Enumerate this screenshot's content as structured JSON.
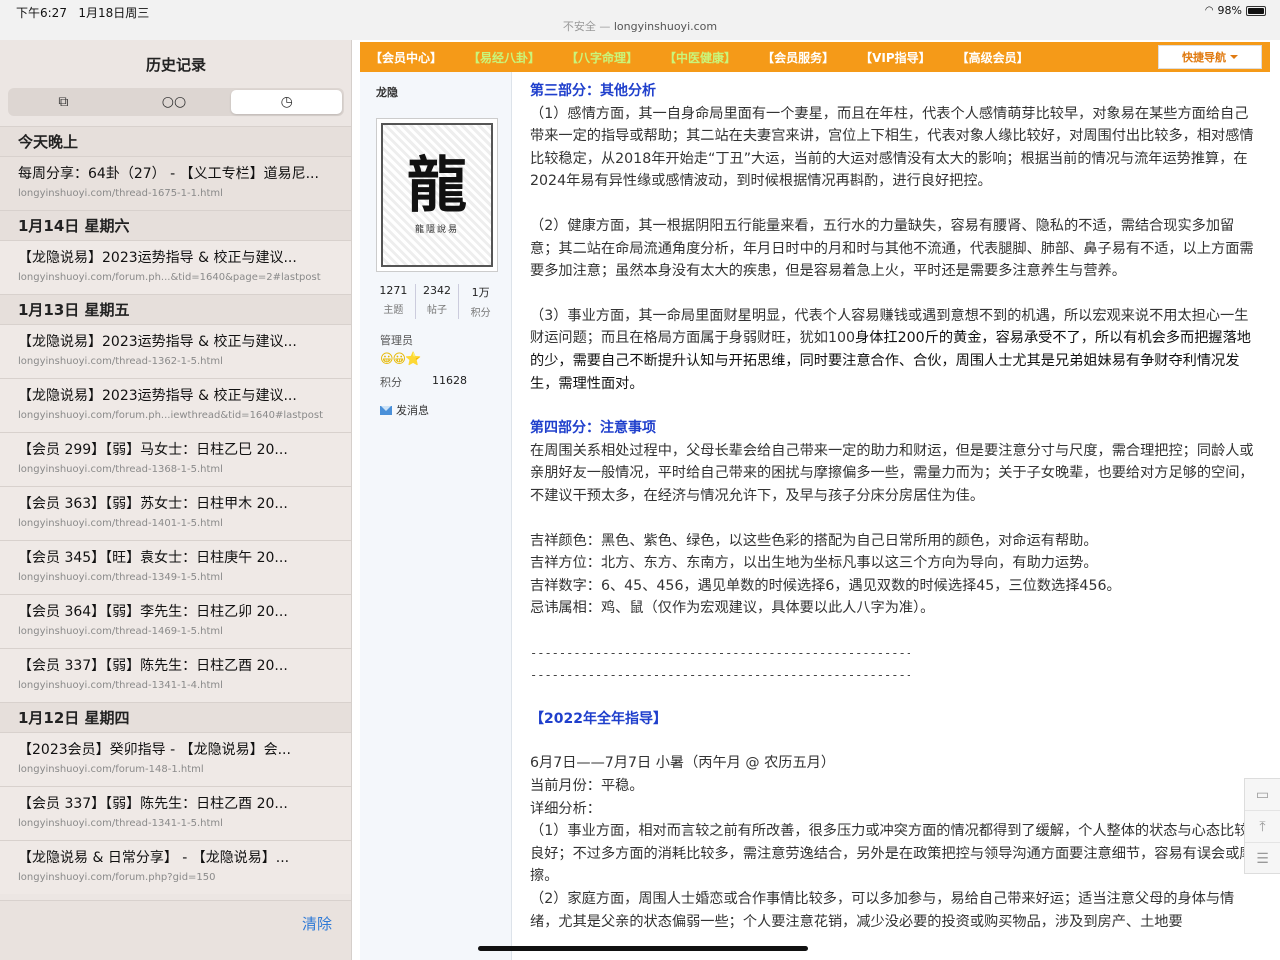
{
  "status_bar": {
    "time": "下午6:27",
    "date": "1月18日周三",
    "url_prefix": "不安全 — ",
    "url": "longyinshuoyi.com",
    "battery": "98%"
  },
  "sidebar": {
    "title": "历史记录",
    "tabs": [
      {
        "icon": "book-icon",
        "glyph": "⧉"
      },
      {
        "icon": "reading-list-icon",
        "glyph": "○○"
      },
      {
        "icon": "history-clock-icon",
        "glyph": "◷"
      }
    ],
    "groups": [
      {
        "header": "今天晚上",
        "items": [
          {
            "title": "每周分享：64卦（27） - 【义工专栏】道易尼...",
            "url": "longyinshuoyi.com/thread-1675-1-1.html"
          }
        ]
      },
      {
        "header": "1月14日 星期六",
        "items": [
          {
            "title": "【龙隐说易】2023运势指导 & 校正与建议...",
            "url": "longyinshuoyi.com/forum.ph...&tid=1640&page=2#lastpost"
          }
        ]
      },
      {
        "header": "1月13日 星期五",
        "items": [
          {
            "title": "【龙隐说易】2023运势指导 & 校正与建议...",
            "url": "longyinshuoyi.com/thread-1362-1-5.html"
          },
          {
            "title": "【龙隐说易】2023运势指导 & 校正与建议...",
            "url": "longyinshuoyi.com/forum.ph...iewthread&tid=1640#lastpost"
          },
          {
            "title": "【会员 299】【弱】马女士：日柱乙巳 20...",
            "url": "longyinshuoyi.com/thread-1368-1-5.html"
          },
          {
            "title": "【会员 363】【弱】苏女士：日柱甲木 20...",
            "url": "longyinshuoyi.com/thread-1401-1-5.html"
          },
          {
            "title": "【会员 345】【旺】袁女士：日柱庚午 20...",
            "url": "longyinshuoyi.com/thread-1349-1-5.html"
          },
          {
            "title": "【会员 364】【弱】李先生：日柱乙卯 20...",
            "url": "longyinshuoyi.com/thread-1469-1-5.html"
          },
          {
            "title": "【会员 337】【弱】陈先生：日柱乙酉 20...",
            "url": "longyinshuoyi.com/thread-1341-1-4.html"
          }
        ]
      },
      {
        "header": "1月12日 星期四",
        "items": [
          {
            "title": "【2023会员】癸卯指导 - 【龙隐说易】会...",
            "url": "longyinshuoyi.com/forum-148-1.html"
          },
          {
            "title": "【会员 337】【弱】陈先生：日柱乙酉 20...",
            "url": "longyinshuoyi.com/thread-1341-1-5.html"
          },
          {
            "title": "【龙隐说易 & 日常分享】 - 【龙隐说易】...",
            "url": "longyinshuoyi.com/forum.php?gid=150"
          }
        ]
      }
    ],
    "clear_label": "清除"
  },
  "nav": {
    "items": [
      {
        "label": "【会员中心】",
        "style": "hl"
      },
      {
        "label": "【易经八卦】",
        "style": "green"
      },
      {
        "label": "【八字命理】",
        "style": "green"
      },
      {
        "label": "【中医健康】",
        "style": "green"
      },
      {
        "label": "【会员服务】",
        "style": "hl"
      },
      {
        "label": "【VIP指导】",
        "style": "hl"
      },
      {
        "label": "【高级会员】",
        "style": "hl"
      }
    ],
    "quick_nav": "快捷导航"
  },
  "profile": {
    "username": "龙隐",
    "seal_char": "龍",
    "seal_sub": "龍隱說易",
    "stats": [
      {
        "value": "1271",
        "label": "主题"
      },
      {
        "value": "2342",
        "label": "帖子"
      },
      {
        "value": "1万",
        "label": "积分"
      }
    ],
    "role": "管理员",
    "badges": "😀😀⭐",
    "points_label": "积分",
    "points_value": "11628",
    "send_message": "发消息"
  },
  "article": {
    "part3_title": "第三部分：其他分析",
    "p3_1": "（1）感情方面，其一自身命局里面有一个妻星，而且在年柱，代表个人感情萌芽比较早，对象易在某些方面给自己带来一定的指导或帮助；其二站在夫妻宫来讲，宫位上下相生，代表对象人缘比较好，对周围付出比较多，相对感情比较稳定，从2018年开始走“丁丑”大运，当前的大运对感情没有太大的影响；根据当前的情况与流年运势推算，在2024年易有异性缘或感情波动，到时候根据情况再斟酌，进行良好把控。",
    "p3_2": "（2）健康方面，其一根据阴阳五行能量来看，五行水的力量缺失，容易有腰肾、隐私的不适，需结合现实多加留意；其二站在命局流通角度分析，年月日时中的月和时与其他不流通，代表腿脚、肺部、鼻子易有不适，以上方面需要多加注意；虽然本身没有太大的疾患，但是容易着急上火，平时还是需要多注意养生与营养。",
    "p3_3a": "（3）事业方面，其一命局里面财星明显，代表个人容易赚钱或遇到意想不到的机遇，所以宏观来说不用太担心一生财运问题；而且在格局方面属于身弱财旺，犹如100",
    "p3_3b": "身体扛200斤的黄金，容易承受不了，所以有机会多而把握落地的少，需要自己不断提升认知与开拓思维，同时要注意合作、合伙，周围人士尤其是兄弟姐妹易有争财夺利情况发生，需理性面对。",
    "part4_title": "第四部分：注意事项",
    "p4": "在周围关系相处过程中，父母长辈会给自己带来一定的助力和财运，但是要注意分寸与尺度，需合理把控；同龄人或亲朋好友一般情况，平时给自己带来的困扰与摩擦偏多一些，需量力而为；关于子女晚辈，也要给对方足够的空间，不建议干预太多，在经济与情况允许下，及早与孩子分床分房居住为佳。",
    "lucky_color": "吉祥颜色：黑色、紫色、绿色，以这些色彩的搭配为自己日常所用的颜色，对命运有帮助。",
    "lucky_direction": "吉祥方位：北方、东方、东南方，以出生地为坐标凡事以这三个方向为导向，有助力运势。",
    "lucky_number": "吉祥数字：6、45、456，遇见单数的时候选择6，遇见双数的时候选择45，三位数选择456。",
    "taboo_zodiac": "忌讳属相：鸡、鼠（仅作为宏观建议，具体要以此人八字为准）。",
    "dashes": "------------------------------------------------------------------",
    "year_title": "【2022年全年指导】",
    "period": "6月7日——7月7日 小暑（丙午月 @ 农历五月）",
    "current_month": "当前月份：平稳。",
    "detail_label": "详细分析：",
    "d1": "（1）事业方面，相对而言较之前有所改善，很多压力或冲突方面的情况都得到了缓解，个人整体的状态与心态比较良好；不过多方面的消耗比较多，需注意劳逸结合，另外是在政策把控与领导沟通方面要注意细节，容易有误会或摩擦。",
    "d2": "（2）家庭方面，周围人士婚恋或合作事情比较多，可以多加参与，易给自己带来好运；适当注意父母的身体与情绪，尤其是父亲的状态偏弱一些；个人要注意花销，减少没必要的投资或购买物品，涉及到房产、土地要"
  },
  "colors": {
    "nav_orange": "#f59a18",
    "section_blue": "#1f3fcc",
    "link_blue": "#2f7ad6"
  }
}
